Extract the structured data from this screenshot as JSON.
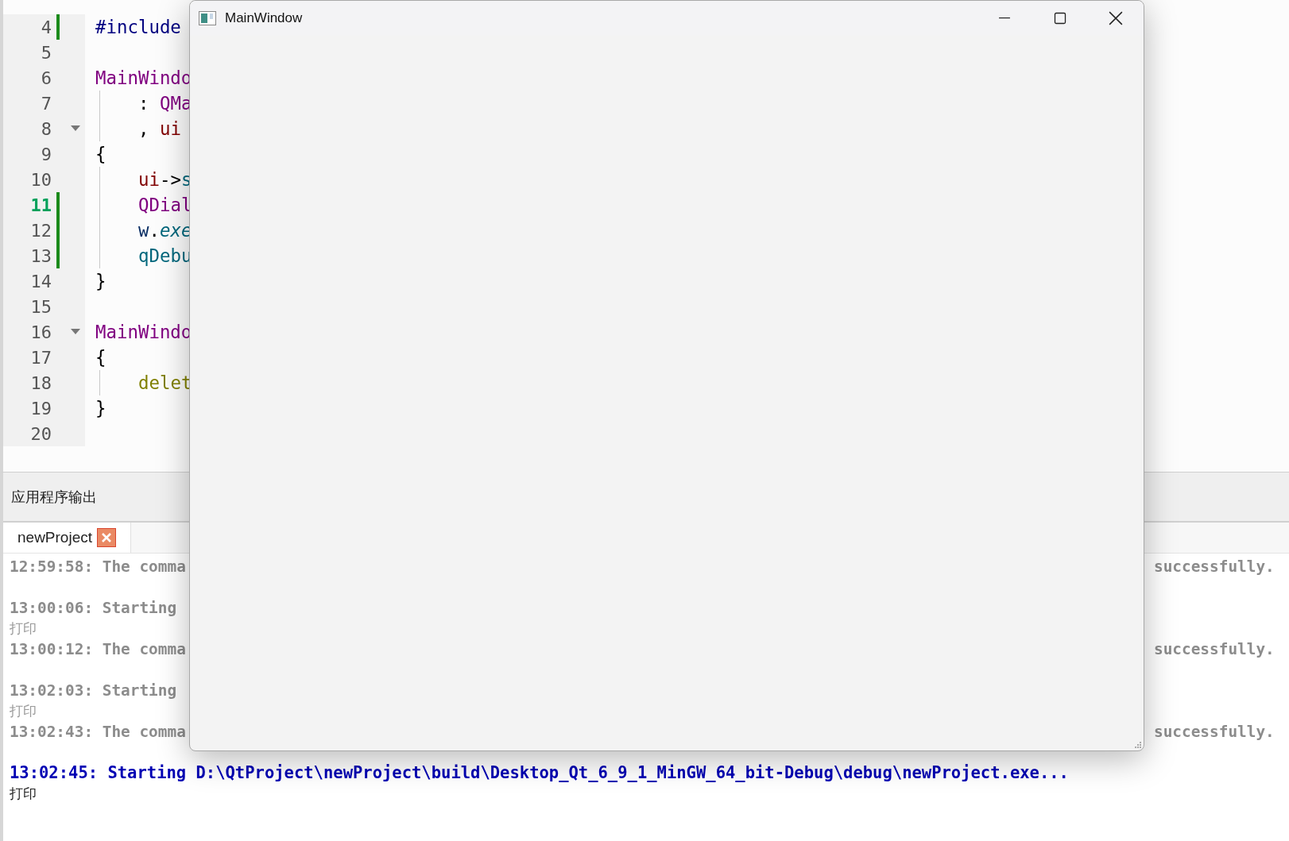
{
  "editor": {
    "lines": [
      {
        "number": "4",
        "changed": true,
        "current": false,
        "tokens": [
          {
            "text": "#include",
            "kind": "preprocessor"
          }
        ]
      },
      {
        "number": "5",
        "changed": false,
        "current": false
      },
      {
        "number": "6",
        "changed": false,
        "current": false,
        "tokens": [
          {
            "text": "MainWindo",
            "kind": "type"
          }
        ]
      },
      {
        "number": "7",
        "changed": false,
        "current": false,
        "indented": true,
        "tokens": [
          {
            "text": ": ",
            "kind": "plain"
          },
          {
            "text": "QMa",
            "kind": "type"
          }
        ]
      },
      {
        "number": "8",
        "changed": false,
        "current": false,
        "indented": true,
        "expanded": true,
        "tokens": [
          {
            "text": ", ",
            "kind": "plain"
          },
          {
            "text": "ui",
            "kind": "field"
          }
        ]
      },
      {
        "number": "9",
        "changed": false,
        "current": false,
        "tokens": [
          {
            "text": "{",
            "kind": "plain"
          }
        ]
      },
      {
        "number": "10",
        "changed": false,
        "current": false,
        "indented": true,
        "tokens": [
          {
            "text": "ui",
            "kind": "field"
          },
          {
            "text": "->",
            "kind": "plain"
          },
          {
            "text": "s",
            "kind": "function"
          }
        ]
      },
      {
        "number": "11",
        "changed": true,
        "current": true,
        "indented": true,
        "tokens": [
          {
            "text": "QDial",
            "kind": "type"
          }
        ]
      },
      {
        "number": "12",
        "changed": true,
        "current": false,
        "indented": true,
        "tokens": [
          {
            "text": "w",
            "kind": "local"
          },
          {
            "text": ".",
            "kind": "plain"
          },
          {
            "text": "exe",
            "kind": "virtual"
          }
        ]
      },
      {
        "number": "13",
        "changed": true,
        "current": false,
        "indented": true,
        "tokens": [
          {
            "text": "qDebu",
            "kind": "function"
          }
        ]
      },
      {
        "number": "14",
        "changed": false,
        "current": false,
        "tokens": [
          {
            "text": "}",
            "kind": "plain"
          }
        ]
      },
      {
        "number": "15",
        "changed": false,
        "current": false
      },
      {
        "number": "16",
        "changed": false,
        "current": false,
        "expanded": true,
        "tokens": [
          {
            "text": "MainWindo",
            "kind": "type"
          }
        ]
      },
      {
        "number": "17",
        "changed": false,
        "current": false,
        "tokens": [
          {
            "text": "{",
            "kind": "plain"
          }
        ]
      },
      {
        "number": "18",
        "changed": false,
        "current": false,
        "indented": true,
        "tokens": [
          {
            "text": "delet",
            "kind": "keyword"
          }
        ]
      },
      {
        "number": "19",
        "changed": false,
        "current": false,
        "tokens": [
          {
            "text": "}",
            "kind": "plain"
          }
        ]
      },
      {
        "number": "20",
        "changed": false,
        "current": false
      }
    ]
  },
  "output_panel": {
    "title": "应用程序输出",
    "tabs": [
      {
        "label": "newProject",
        "selected": true
      }
    ],
    "lines": [
      {
        "text": "12:59:58: The comma",
        "right_text": "successfully.",
        "kind": "old-status",
        "gap_before": false
      },
      {
        "text": "13:00:06: Starting",
        "kind": "old-status",
        "gap_before": true
      },
      {
        "text": "打印",
        "kind": "old-print",
        "gap_before": false
      },
      {
        "text": "13:00:12: The comma",
        "right_text": "successfully.",
        "kind": "old-status",
        "gap_before": false
      },
      {
        "text": "13:02:03: Starting",
        "kind": "old-status",
        "gap_before": true
      },
      {
        "text": "打印",
        "kind": "old-print",
        "gap_before": false
      },
      {
        "text": "13:02:43: The comma",
        "right_text": "successfully.",
        "kind": "old-status",
        "gap_before": false
      },
      {
        "text": "13:02:45: Starting D:\\QtProject\\newProject\\build\\Desktop_Qt_6_9_1_MinGW_64_bit-Debug\\debug\\newProject.exe...",
        "kind": "status",
        "gap_before": true
      },
      {
        "text": "打印",
        "kind": "print",
        "gap_before": false
      }
    ]
  },
  "dialog": {
    "title": "MainWindow"
  }
}
